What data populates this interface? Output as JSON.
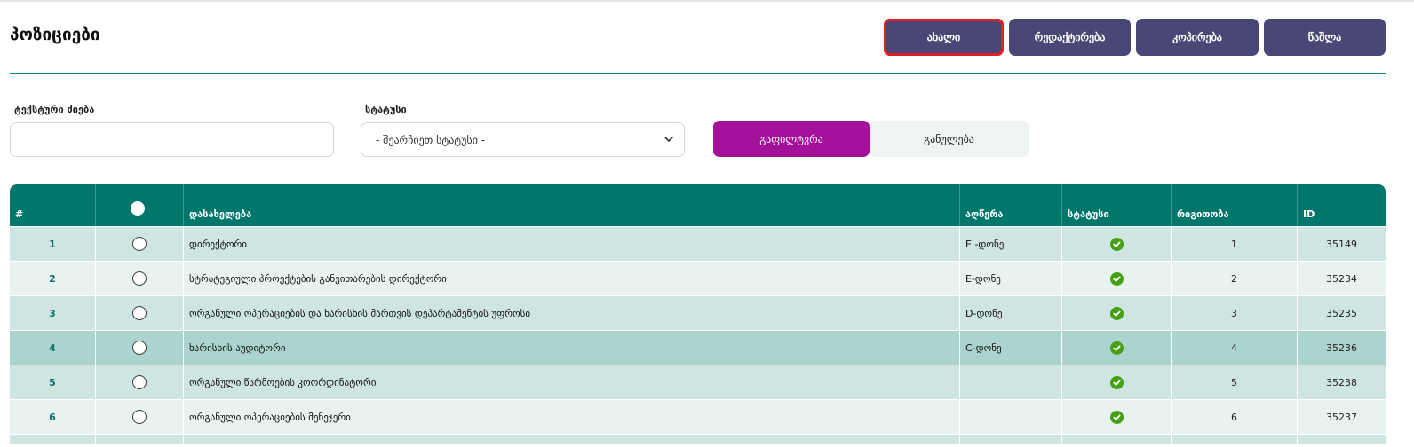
{
  "page": {
    "title": "პოზიციები"
  },
  "toolbar": {
    "buttons": [
      {
        "label": "ახალი",
        "active": true
      },
      {
        "label": "რედაქტირება"
      },
      {
        "label": "კოპირება"
      },
      {
        "label": "წაშლა"
      }
    ]
  },
  "filters": {
    "text_search_label": "ტექსტური ძიება",
    "text_search_value": "",
    "status_label": "სტატუსი",
    "status_selected": "- შეარჩიეთ სტატუსი -",
    "filter_button": "გაფილტვრა",
    "clear_button": "განულება"
  },
  "table": {
    "columns": [
      "#",
      "",
      "დასახელება",
      "აღწერა",
      "სტატუსი",
      "რიგითობა",
      "ID"
    ],
    "rows": [
      {
        "num": "1",
        "name": "დირექტორი",
        "desc": "E -დონე",
        "status": "active",
        "order": "1",
        "id": "35149"
      },
      {
        "num": "2",
        "name": "სტრატეგიული პროექტების განვითარების დირექტორი",
        "desc": "E-დონე",
        "status": "active",
        "order": "2",
        "id": "35234"
      },
      {
        "num": "3",
        "name": "ორგანული ოპერაციების და ხარისხის მართვის დეპარტამენტის უფროსი",
        "desc": "D-დონე",
        "status": "active",
        "order": "3",
        "id": "35235"
      },
      {
        "num": "4",
        "name": "ხარისხის აუდიტორი",
        "desc": "C-დონე",
        "status": "active",
        "order": "4",
        "id": "35236"
      },
      {
        "num": "5",
        "name": "ორგანული წარმოების კოორდინატორი",
        "desc": "",
        "status": "active",
        "order": "5",
        "id": "35238"
      },
      {
        "num": "6",
        "name": "ორგანული ოპერაციების მენეჯერი",
        "desc": "",
        "status": "active",
        "order": "6",
        "id": "35237"
      }
    ]
  },
  "colors": {
    "header": "#01776c",
    "toolbar_button": "#4a4676",
    "filter_button": "#a3119a",
    "status_ok": "#45a014",
    "highlight": "#e01f26"
  },
  "icons": {
    "status_active": "check-circle-icon",
    "select_arrow": "chevron-down-icon"
  }
}
